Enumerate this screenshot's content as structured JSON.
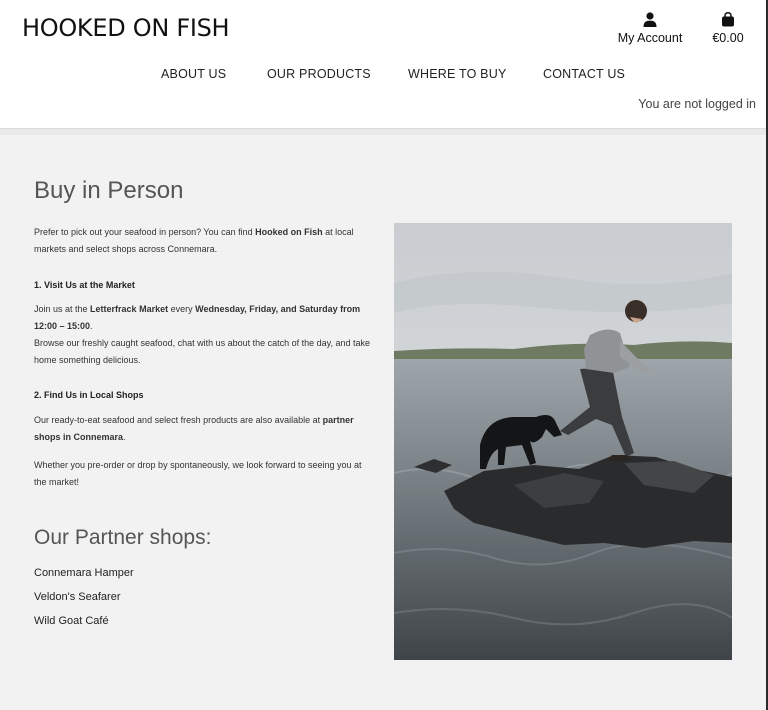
{
  "header": {
    "logo": "HOOKED ON FISH",
    "account_label": "My Account",
    "account_icon": "user-icon",
    "cart_total": "€0.00",
    "cart_icon": "shopping-bag-icon",
    "login_status": "You are not logged in"
  },
  "nav": {
    "items": [
      {
        "label": "ABOUT US"
      },
      {
        "label": "OUR PRODUCTS"
      },
      {
        "label": "WHERE TO BUY"
      },
      {
        "label": "CONTACT US"
      }
    ]
  },
  "main": {
    "title": "Buy in Person",
    "intro": {
      "pre": "Prefer to pick out your seafood in person? You can find ",
      "bold": "Hooked on Fish",
      "post": " at local markets and select shops across Connemara."
    },
    "section1": {
      "heading": "1. Visit Us at the Market",
      "p1_pre": "Join us at the ",
      "p1_bold1": "Letterfrack Market",
      "p1_mid": " every ",
      "p1_bold2": "Wednesday, Friday, and Saturday from 12:00 – 15:00",
      "p1_end": ".",
      "p2": "Browse our freshly caught seafood, chat with us about the catch of the day, and take home something delicious."
    },
    "section2": {
      "heading": "2. Find Us in Local Shops",
      "p1_pre": "Our ready-to-eat seafood and select fresh products are also available at ",
      "p1_bold": "partner shops in Connemara",
      "p1_end": ".",
      "p2": "Whether you pre-order or drop by spontaneously, we look forward to seeing you at the market!"
    },
    "partners_title": "Our Partner shops:",
    "partners": [
      {
        "name": "Connemara Hamper"
      },
      {
        "name": "Veldon's Seafarer"
      },
      {
        "name": "Wild Goat Café"
      }
    ]
  },
  "colors": {
    "page_bg": "#f2f2f2",
    "header_bg": "#ffffff",
    "heading_text": "#555555"
  }
}
